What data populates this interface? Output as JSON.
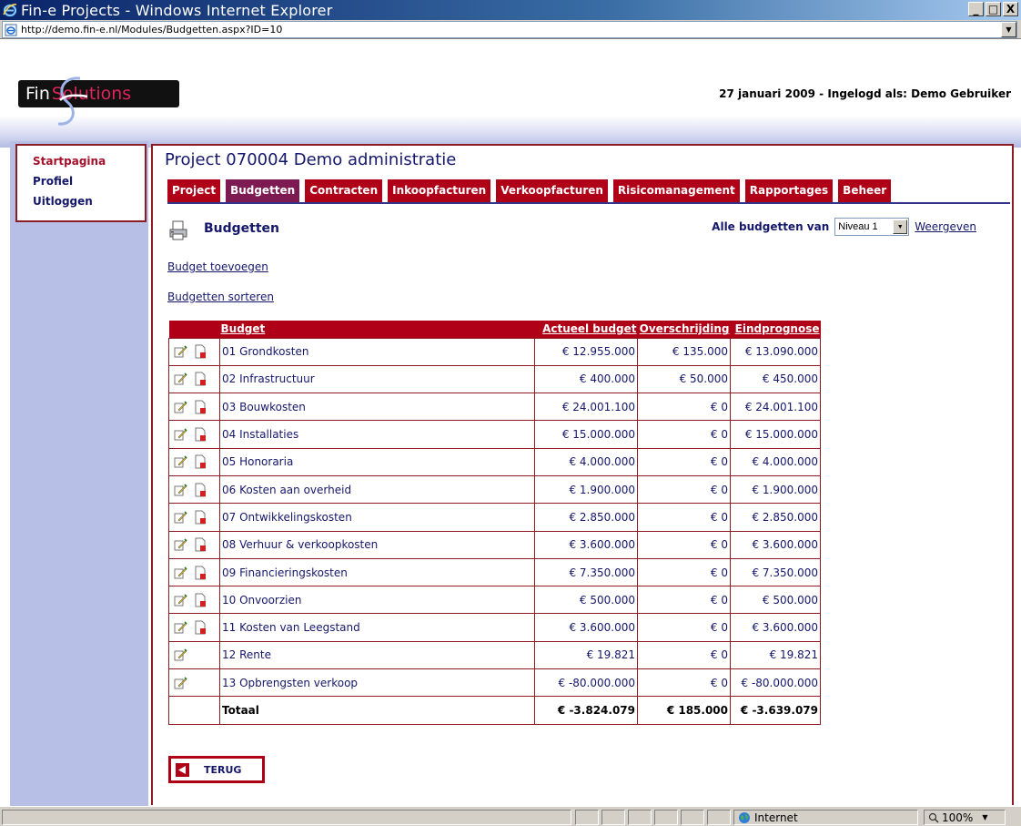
{
  "window": {
    "title": "Fin-e Projects - Windows Internet Explorer",
    "minimize": "_",
    "maximize": "□",
    "close": "X"
  },
  "address": {
    "url": "http://demo.fin-e.nl/Modules/Budgetten.aspx?ID=10"
  },
  "header": {
    "logo_left": "Fin",
    "logo_right": "Solutions",
    "info": "27 januari 2009 - Ingelogd als: Demo Gebruiker"
  },
  "sidebar": {
    "items": [
      {
        "label": "Startpagina",
        "active": true
      },
      {
        "label": "Profiel",
        "active": false
      },
      {
        "label": "Uitloggen",
        "active": false
      }
    ]
  },
  "main": {
    "project_title": "Project 070004 Demo administratie",
    "tabs": [
      {
        "label": "Project",
        "active": false
      },
      {
        "label": "Budgetten",
        "active": true
      },
      {
        "label": "Contracten",
        "active": false
      },
      {
        "label": "Inkoopfacturen",
        "active": false
      },
      {
        "label": "Verkoopfacturen",
        "active": false
      },
      {
        "label": "Risicomanagement",
        "active": false
      },
      {
        "label": "Rapportages",
        "active": false
      },
      {
        "label": "Beheer",
        "active": false
      }
    ],
    "section_title": "Budgetten",
    "filter_label": "Alle budgetten van",
    "filter_value": "Niveau 1",
    "filter_button": "Weergeven",
    "link_add": "Budget toevoegen",
    "link_sort": "Budgetten sorteren",
    "back_label": "TERUG"
  },
  "table": {
    "headers": [
      "Budget",
      "Actueel budget",
      "Overschrijding",
      "Eindprognose"
    ],
    "rows": [
      {
        "name": "01 Grondkosten",
        "actueel": "€ 12.955.000",
        "over": "€ 135.000",
        "eind": "€ 13.090.000",
        "deletable": true
      },
      {
        "name": "02 Infrastructuur",
        "actueel": "€ 400.000",
        "over": "€ 50.000",
        "eind": "€ 450.000",
        "deletable": true
      },
      {
        "name": "03 Bouwkosten",
        "actueel": "€ 24.001.100",
        "over": "€ 0",
        "eind": "€ 24.001.100",
        "deletable": true
      },
      {
        "name": "04 Installaties",
        "actueel": "€ 15.000.000",
        "over": "€ 0",
        "eind": "€ 15.000.000",
        "deletable": true
      },
      {
        "name": "05 Honoraria",
        "actueel": "€ 4.000.000",
        "over": "€ 0",
        "eind": "€ 4.000.000",
        "deletable": true
      },
      {
        "name": "06 Kosten aan overheid",
        "actueel": "€ 1.900.000",
        "over": "€ 0",
        "eind": "€ 1.900.000",
        "deletable": true
      },
      {
        "name": "07 Ontwikkelingskosten",
        "actueel": "€ 2.850.000",
        "over": "€ 0",
        "eind": "€ 2.850.000",
        "deletable": true
      },
      {
        "name": "08 Verhuur & verkoopkosten",
        "actueel": "€ 3.600.000",
        "over": "€ 0",
        "eind": "€ 3.600.000",
        "deletable": true
      },
      {
        "name": "09 Financieringskosten",
        "actueel": "€ 7.350.000",
        "over": "€ 0",
        "eind": "€ 7.350.000",
        "deletable": true
      },
      {
        "name": "10 Onvoorzien",
        "actueel": "€ 500.000",
        "over": "€ 0",
        "eind": "€ 500.000",
        "deletable": true
      },
      {
        "name": "11 Kosten van Leegstand",
        "actueel": "€ 3.600.000",
        "over": "€ 0",
        "eind": "€ 3.600.000",
        "deletable": true
      },
      {
        "name": "12 Rente",
        "actueel": "€ 19.821",
        "over": "€ 0",
        "eind": "€ 19.821",
        "deletable": false
      },
      {
        "name": "13 Opbrengsten verkoop",
        "actueel": "€ -80.000.000",
        "over": "€ 0",
        "eind": "€ -80.000.000",
        "deletable": false
      }
    ],
    "total": {
      "name": "Totaal",
      "actueel": "€ -3.824.079",
      "over": "€ 185.000",
      "eind": "€ -3.639.079"
    }
  },
  "statusbar": {
    "zone": "Internet",
    "zoom": "100%"
  },
  "colors": {
    "brand_red": "#b00018",
    "active_tab": "#7d1a52",
    "navy": "#15176b",
    "sidebar_bg": "#b8bfe7"
  }
}
